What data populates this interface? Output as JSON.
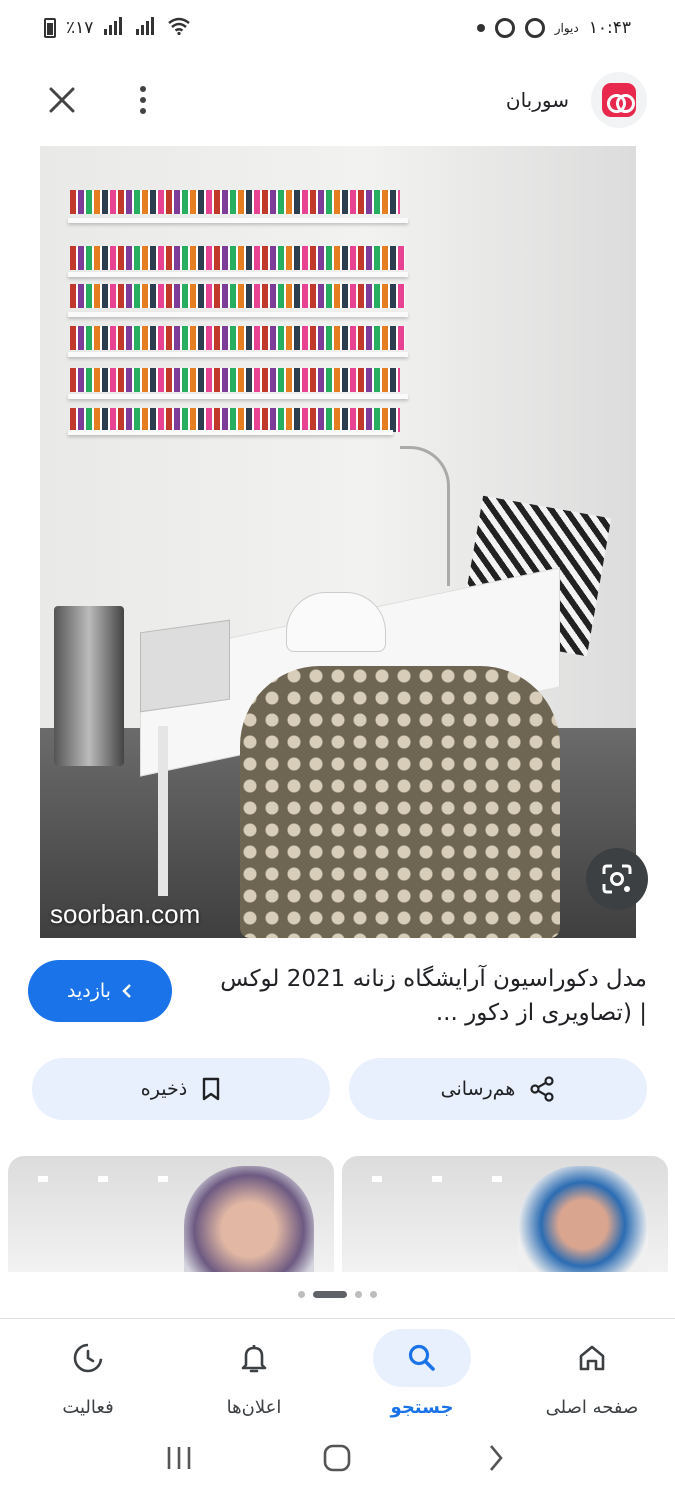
{
  "status_bar": {
    "time": "۱۰:۴۳",
    "operator_label": "دیوار",
    "battery_percent": "٪۱۷"
  },
  "header": {
    "site_name": "سوربان",
    "close_icon": "close-icon",
    "more_icon": "more-vert-icon"
  },
  "main_image": {
    "watermark": "soorban.com",
    "lens_icon": "google-lens-icon"
  },
  "result": {
    "title": "مدل دکوراسیون آرایشگاه زنانه 2021 لوکس | (تصاویری از دکور ...",
    "visit_label": "بازدید"
  },
  "actions": {
    "share_label": "هم‌رسانی",
    "save_label": "ذخیره"
  },
  "pagination": {
    "total": 4,
    "active_index": 1
  },
  "bottom_nav": {
    "home_label": "صفحه اصلی",
    "search_label": "جستجو",
    "notifications_label": "اعلان‌ها",
    "activity_label": "فعالیت"
  },
  "colors": {
    "accent": "#1a73e8",
    "pill_background": "#e8f0fe",
    "brand": "#e8294d"
  }
}
